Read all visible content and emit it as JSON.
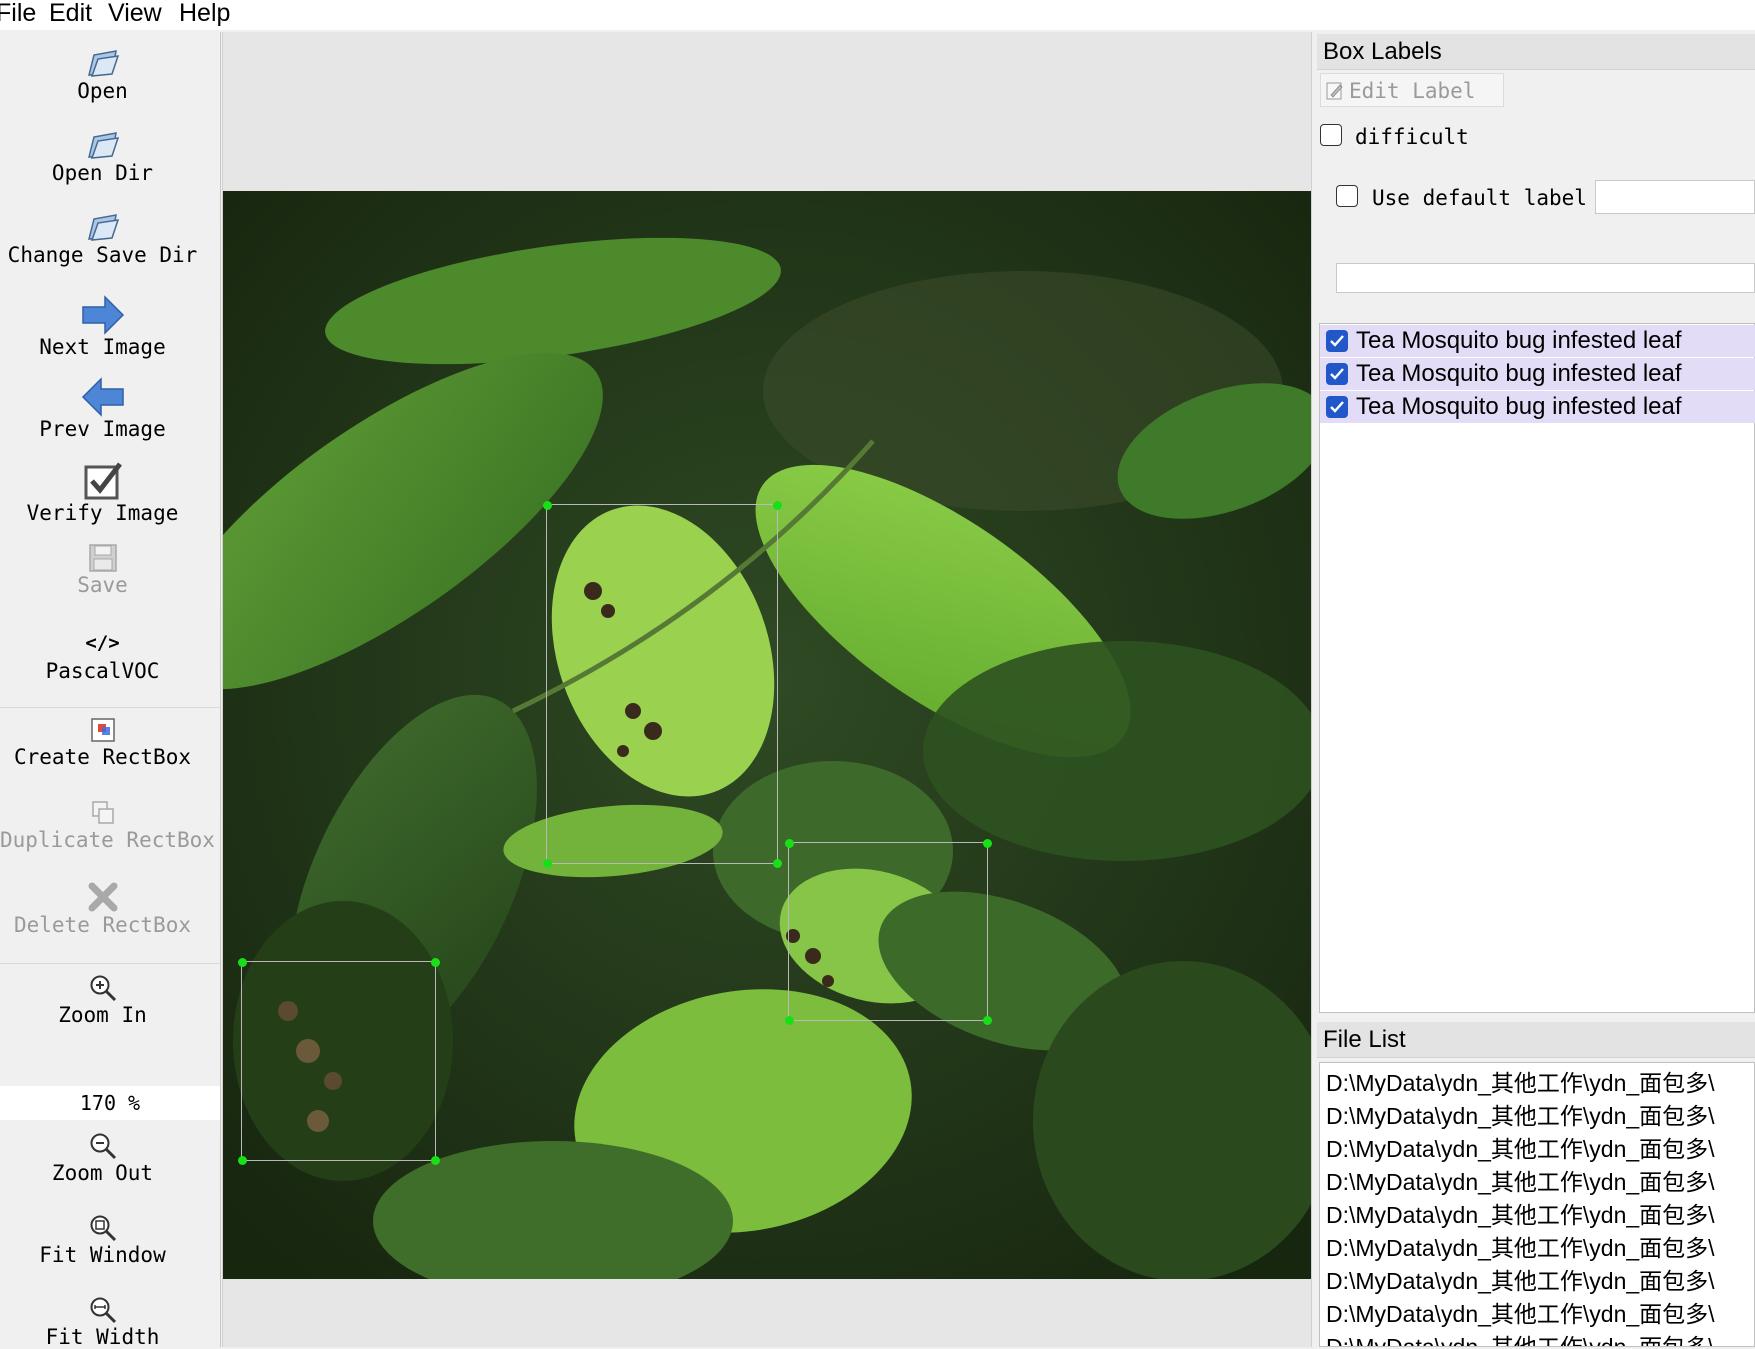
{
  "menu": [
    "File",
    "Edit",
    "View",
    "Help"
  ],
  "toolbar": {
    "open": "Open",
    "open_dir": "Open Dir",
    "change_save_dir": "Change Save Dir",
    "next_image": "Next Image",
    "prev_image": "Prev Image",
    "verify_image": "Verify Image",
    "save": "Save",
    "format_icon_text": "</>",
    "format": "PascalVOC",
    "create_rectbox": "Create RectBox",
    "duplicate_rectbox": "Duplicate RectBox",
    "delete_rectbox": "Delete RectBox",
    "zoom_in": "Zoom In",
    "zoom_value": "170 %",
    "zoom_out": "Zoom Out",
    "fit_window": "Fit Window",
    "fit_width": "Fit Width"
  },
  "box_labels": {
    "title": "Box Labels",
    "edit_label": "Edit Label",
    "difficult": "difficult",
    "difficult_checked": false,
    "use_default_label": "Use default label",
    "use_default_checked": false,
    "default_label_value": "",
    "filter_value": "",
    "labels": [
      {
        "text": "Tea Mosquito bug infested leaf",
        "checked": true
      },
      {
        "text": "Tea Mosquito bug infested leaf",
        "checked": true
      },
      {
        "text": "Tea Mosquito bug infested leaf",
        "checked": true
      }
    ]
  },
  "file_list": {
    "title": "File List",
    "items": [
      "D:\\MyData\\ydn_其他工作\\ydn_面包多\\",
      "D:\\MyData\\ydn_其他工作\\ydn_面包多\\",
      "D:\\MyData\\ydn_其他工作\\ydn_面包多\\",
      "D:\\MyData\\ydn_其他工作\\ydn_面包多\\",
      "D:\\MyData\\ydn_其他工作\\ydn_面包多\\",
      "D:\\MyData\\ydn_其他工作\\ydn_面包多\\",
      "D:\\MyData\\ydn_其他工作\\ydn_面包多\\",
      "D:\\MyData\\ydn_其他工作\\ydn_面包多\\",
      "D:\\MyData\\ydn_其他工作\\ydn_面包多\\"
    ]
  },
  "colors": {
    "handle": "#18e018",
    "label_row_bg": "#e3dcf6",
    "checkbox_checked": "#2157c8"
  }
}
